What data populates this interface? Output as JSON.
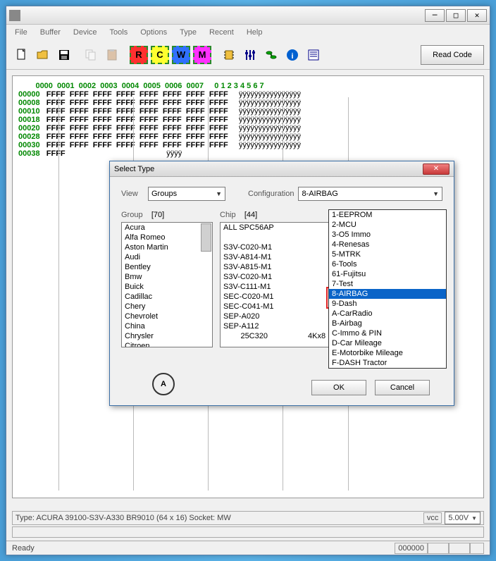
{
  "menus": [
    "File",
    "Buffer",
    "Device",
    "Tools",
    "Options",
    "Type",
    "Recent",
    "Help"
  ],
  "toolbar": {
    "readcode": "Read Code"
  },
  "hex": {
    "headers": [
      "0000",
      "0001",
      "0002",
      "0003",
      "0004",
      "0005",
      "0006",
      "0007"
    ],
    "asciihdr": "0 1 2 3 4 5 6 7",
    "rows": [
      {
        "addr": "00000",
        "data": [
          "FFFF",
          "FFFF",
          "FFFF",
          "FFFF",
          "FFFF",
          "FFFF",
          "FFFF",
          "FFFF"
        ],
        "ascii": "ÿÿÿÿÿÿÿÿÿÿÿÿÿÿÿÿ"
      },
      {
        "addr": "00008",
        "data": [
          "FFFF",
          "FFFF",
          "FFFF",
          "FFFF",
          "FFFF",
          "FFFF",
          "FFFF",
          "FFFF"
        ],
        "ascii": "ÿÿÿÿÿÿÿÿÿÿÿÿÿÿÿÿ"
      },
      {
        "addr": "00010",
        "data": [
          "FFFF",
          "FFFF",
          "FFFF",
          "FFFF",
          "FFFF",
          "FFFF",
          "FFFF",
          "FFFF"
        ],
        "ascii": "ÿÿÿÿÿÿÿÿÿÿÿÿÿÿÿÿ"
      },
      {
        "addr": "00018",
        "data": [
          "FFFF",
          "FFFF",
          "FFFF",
          "FFFF",
          "FFFF",
          "FFFF",
          "FFFF",
          "FFFF"
        ],
        "ascii": "ÿÿÿÿÿÿÿÿÿÿÿÿÿÿÿÿ"
      },
      {
        "addr": "00020",
        "data": [
          "FFFF",
          "FFFF",
          "FFFF",
          "FFFF",
          "FFFF",
          "FFFF",
          "FFFF",
          "FFFF"
        ],
        "ascii": "ÿÿÿÿÿÿÿÿÿÿÿÿÿÿÿÿ"
      },
      {
        "addr": "00028",
        "data": [
          "FFFF",
          "FFFF",
          "FFFF",
          "FFFF",
          "FFFF",
          "FFFF",
          "FFFF",
          "FFFF"
        ],
        "ascii": "ÿÿÿÿÿÿÿÿÿÿÿÿÿÿÿÿ"
      },
      {
        "addr": "00030",
        "data": [
          "FFFF",
          "FFFF",
          "FFFF",
          "FFFF",
          "FFFF",
          "FFFF",
          "FFFF",
          "FFFF"
        ],
        "ascii": "ÿÿÿÿÿÿÿÿÿÿÿÿÿÿÿÿ"
      },
      {
        "addr": "00038",
        "data": [
          "FFFF"
        ],
        "ascii": "ÿÿÿÿ"
      }
    ]
  },
  "dialog": {
    "title": "Select Type",
    "view_label": "View",
    "view_value": "Groups",
    "config_label": "Configuration",
    "config_value": "8-AIRBAG",
    "group_label": "Group",
    "group_count": "[70]",
    "chip_label": "Chip",
    "chip_count": "[44]",
    "groups": [
      "Acura",
      "Alfa Romeo",
      "Aston Martin",
      "Audi",
      "Bentley",
      "Bmw",
      "Buick",
      "Cadillac",
      "Chery",
      "Chevrolet",
      "China",
      "Chrysler",
      "Citroen"
    ],
    "chips": [
      "ALL  SPC56AP",
      "",
      "S3V-C020-M1",
      "S3V-A814-M1",
      "S3V-A815-M1",
      "S3V-C020-M1",
      "S3V-C111-M1",
      "SEC-C020-M1",
      "SEC-C041-M1",
      "SEP-A020",
      "SEP-A112"
    ],
    "chip_extra_left": "25C320",
    "chip_extra_right": "4Kx8",
    "config_options": [
      "1-EEPROM",
      "2-MCU",
      "3-O5 Immo",
      "4-Renesas",
      "5-MTRK",
      "6-Tools",
      "61-Fujitsu",
      "7-Test",
      "8-AIRBAG",
      "9-Dash",
      "A-CarRadio",
      "B-Airbag",
      "C-Immo & PIN",
      "D-Car Mileage",
      "E-Motorbike Mileage",
      "F-DASH Tractor"
    ],
    "config_selected_index": 8,
    "ok": "OK",
    "cancel": "Cancel",
    "logo_text": "A"
  },
  "status": {
    "type_label": "Type: ACURA 39100-S3V-A330 BR9010 (64 x 16)   Socket: MW",
    "vcc_label": "vcc",
    "vcc_value": "5.00V",
    "ready": "Ready",
    "counter": "000000"
  }
}
